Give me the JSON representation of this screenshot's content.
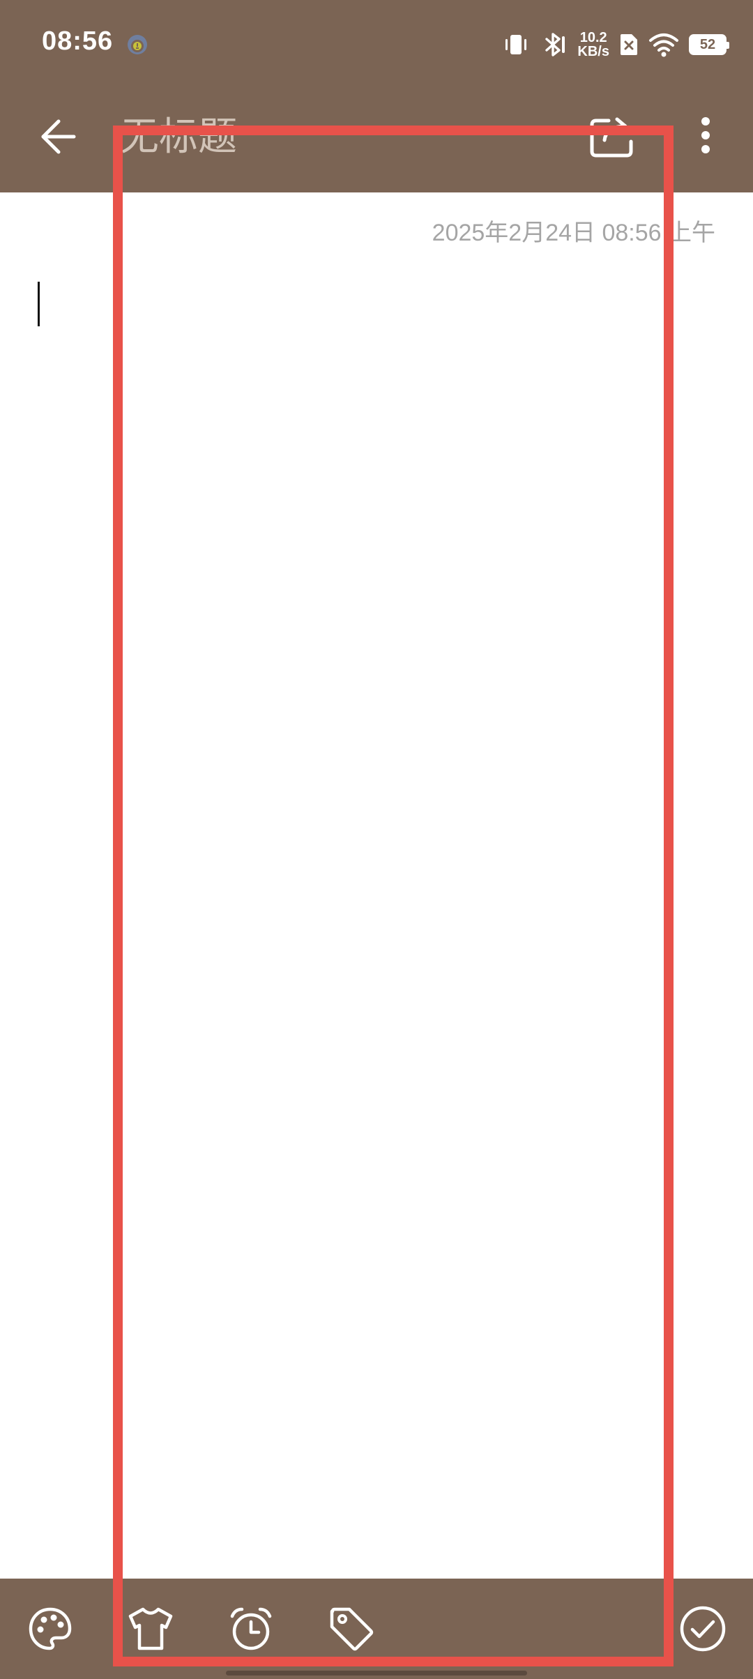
{
  "status_bar": {
    "time": "08:56",
    "net_speed_value": "10.2",
    "net_speed_unit": "KB/s",
    "battery_level": "52"
  },
  "app_bar": {
    "title_placeholder": "无标题"
  },
  "note": {
    "timestamp": "2025年2月24日 08:56 上午",
    "body_value": ""
  },
  "colors": {
    "header_bg": "#7b6454",
    "toolbar_bg": "#7b6454",
    "highlight": "#e8524a",
    "timestamp_text": "#a5a5a5"
  },
  "icons": {
    "back": "arrow-left-icon",
    "share": "share-icon",
    "more": "more-vert-icon",
    "palette": "palette-icon",
    "theme": "tshirt-icon",
    "reminder": "alarm-clock-icon",
    "tag": "tag-icon",
    "done": "check-circle-icon"
  }
}
